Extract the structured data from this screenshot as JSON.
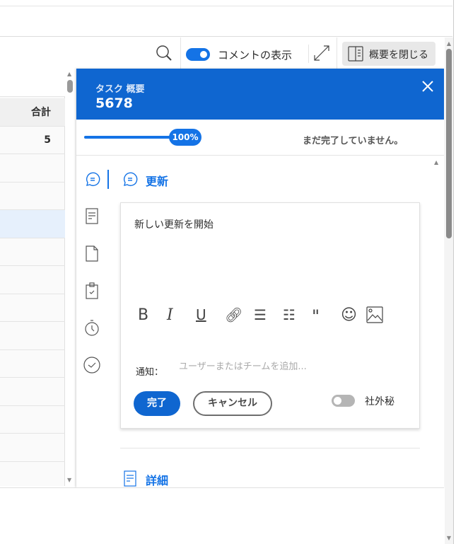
{
  "toolbar": {
    "show_comments_label": "コメントの表示",
    "show_comments_on": true,
    "close_summary_label": "概要を閉じる"
  },
  "table": {
    "header": "合計",
    "rows": [
      "5",
      "",
      "",
      "",
      "",
      "",
      "",
      "",
      "",
      "",
      "",
      "",
      ""
    ],
    "selected_row": 3
  },
  "panel": {
    "subtitle": "タスク 概要",
    "title": "5678",
    "progress": {
      "percent": 100,
      "label": "100%"
    },
    "status": "まだ完了していません。",
    "updates_title": "更新",
    "editor_text": "新しい更新を開始",
    "notify_label": "通知：",
    "notify_placeholder": "ユーザーまたはチームを追加...",
    "done_label": "完了",
    "cancel_label": "キャンセル",
    "confidential_label": "社外秘",
    "confidential_on": false,
    "details_title": "詳細"
  },
  "colors": {
    "accent": "#0f66d0"
  }
}
